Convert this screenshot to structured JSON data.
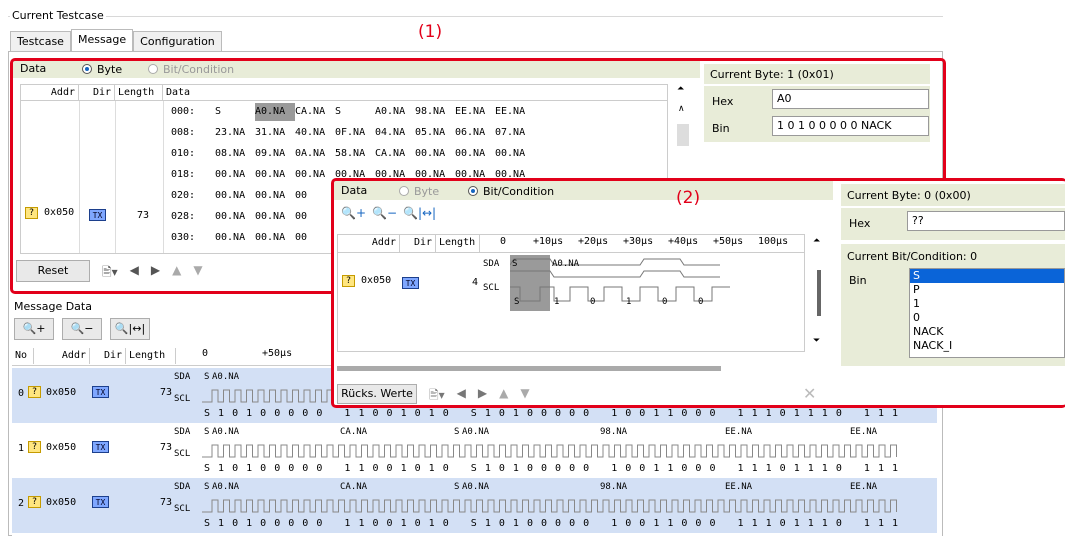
{
  "group_title": "Current Testcase",
  "tabs": [
    "Testcase",
    "Message",
    "Configuration"
  ],
  "callout1": "(1)",
  "callout2": "(2)",
  "panel1": {
    "title": "Data",
    "radio_byte": "Byte",
    "radio_bit": "Bit/Condition",
    "columns": [
      "Addr",
      "Dir",
      "Length",
      "Data"
    ],
    "row": {
      "q": "?",
      "addr": "0x050",
      "dir": "TX",
      "length": "73"
    },
    "hex_rows": [
      {
        "offset": "000:",
        "bytes": [
          "S",
          "A0.NA",
          "CA.NA",
          "S",
          "A0.NA",
          "98.NA",
          "EE.NA",
          "EE.NA"
        ]
      },
      {
        "offset": "008:",
        "bytes": [
          "23.NA",
          "31.NA",
          "40.NA",
          "0F.NA",
          "04.NA",
          "05.NA",
          "06.NA",
          "07.NA"
        ]
      },
      {
        "offset": "010:",
        "bytes": [
          "08.NA",
          "09.NA",
          "0A.NA",
          "58.NA",
          "CA.NA",
          "00.NA",
          "00.NA",
          "00.NA"
        ]
      },
      {
        "offset": "018:",
        "bytes": [
          "00.NA",
          "00.NA",
          "00.NA",
          "00.NA",
          "00.NA",
          "00.NA",
          "00.NA",
          "00.NA"
        ]
      },
      {
        "offset": "020:",
        "bytes": [
          "00.NA",
          "00.NA",
          "00"
        ]
      },
      {
        "offset": "028:",
        "bytes": [
          "00.NA",
          "00.NA",
          "00"
        ]
      },
      {
        "offset": "030:",
        "bytes": [
          "00.NA",
          "00.NA",
          "00"
        ]
      }
    ],
    "reset_label": "Reset",
    "current_byte": "Current Byte: 1 (0x01)",
    "hex_label": "Hex",
    "hex_value": "A0",
    "bin_label": "Bin",
    "bin_value": "1 0 1 0 0 0 0 0 NACK"
  },
  "panel2": {
    "title": "Data",
    "radio_byte": "Byte",
    "radio_bit": "Bit/Condition",
    "columns": [
      "Addr",
      "Dir",
      "Length"
    ],
    "ticks": [
      "0",
      "+10µs",
      "+20µs",
      "+30µs",
      "+40µs",
      "+50µs",
      "100µs"
    ],
    "row": {
      "q": "?",
      "addr": "0x050",
      "dir": "TX",
      "length": "4"
    },
    "sda": "SDA",
    "scl": "SCL",
    "sda_byte": "A0.NA",
    "sda_s": "S",
    "scl_bits": [
      "S",
      "1",
      "0",
      "1",
      "0",
      "0"
    ],
    "reset_label": "Rücks. Werte",
    "current_byte": "Current Byte: 0 (0x00)",
    "hex_label": "Hex",
    "hex_value": "??",
    "current_bit": "Current Bit/Condition: 0",
    "bin_label": "Bin",
    "bin_options": [
      "S",
      "P",
      "1",
      "0",
      "NACK",
      "NACK_I"
    ],
    "bin_selected": "S"
  },
  "message_data": {
    "title": "Message Data",
    "columns": [
      "No",
      "Addr",
      "Dir",
      "Length"
    ],
    "ticks": [
      "0",
      "+50µs"
    ],
    "sda": "SDA",
    "scl": "SCL",
    "rows": [
      {
        "no": "0",
        "q": "?",
        "addr": "0x050",
        "dir": "TX",
        "length": "73",
        "sda_labels": [
          "S",
          "A0.NA"
        ],
        "bits": "S 1 0 1 0 0 0 0 0   1 1 0 0 1 0 1 0   S 1 0 1 0 0 0 0 0   1 0 0 1 1 0 0 0   1 1 1 0 1 1 1 0   1 1 1"
      },
      {
        "no": "1",
        "q": "?",
        "addr": "0x050",
        "dir": "TX",
        "length": "73",
        "sda_labels": [
          "S",
          "A0.NA",
          "CA.NA",
          "S",
          "A0.NA",
          "98.NA",
          "EE.NA",
          "EE.NA"
        ],
        "bits": "S 1 0 1 0 0 0 0 0   1 1 0 0 1 0 1 0   S 1 0 1 0 0 0 0 0   1 0 0 1 1 0 0 0   1 1 1 0 1 1 1 0   1 1 1"
      },
      {
        "no": "2",
        "q": "?",
        "addr": "0x050",
        "dir": "TX",
        "length": "73",
        "sda_labels": [
          "S",
          "A0.NA",
          "CA.NA",
          "S",
          "A0.NA",
          "98.NA",
          "EE.NA",
          "EE.NA"
        ],
        "bits": "S 1 0 1 0 0 0 0 0   1 1 0 0 1 0 1 0   S 1 0 1 0 0 0 0 0   1 0 0 1 1 0 0 0   1 1 1 0 1 1 1 0   1 1 1"
      }
    ]
  },
  "colors": {
    "highlight_red": "#e2001a",
    "row_blue": "#d3e0f5",
    "bar_green": "#e8ecd8",
    "tx_blue": "#7fa7ff"
  }
}
